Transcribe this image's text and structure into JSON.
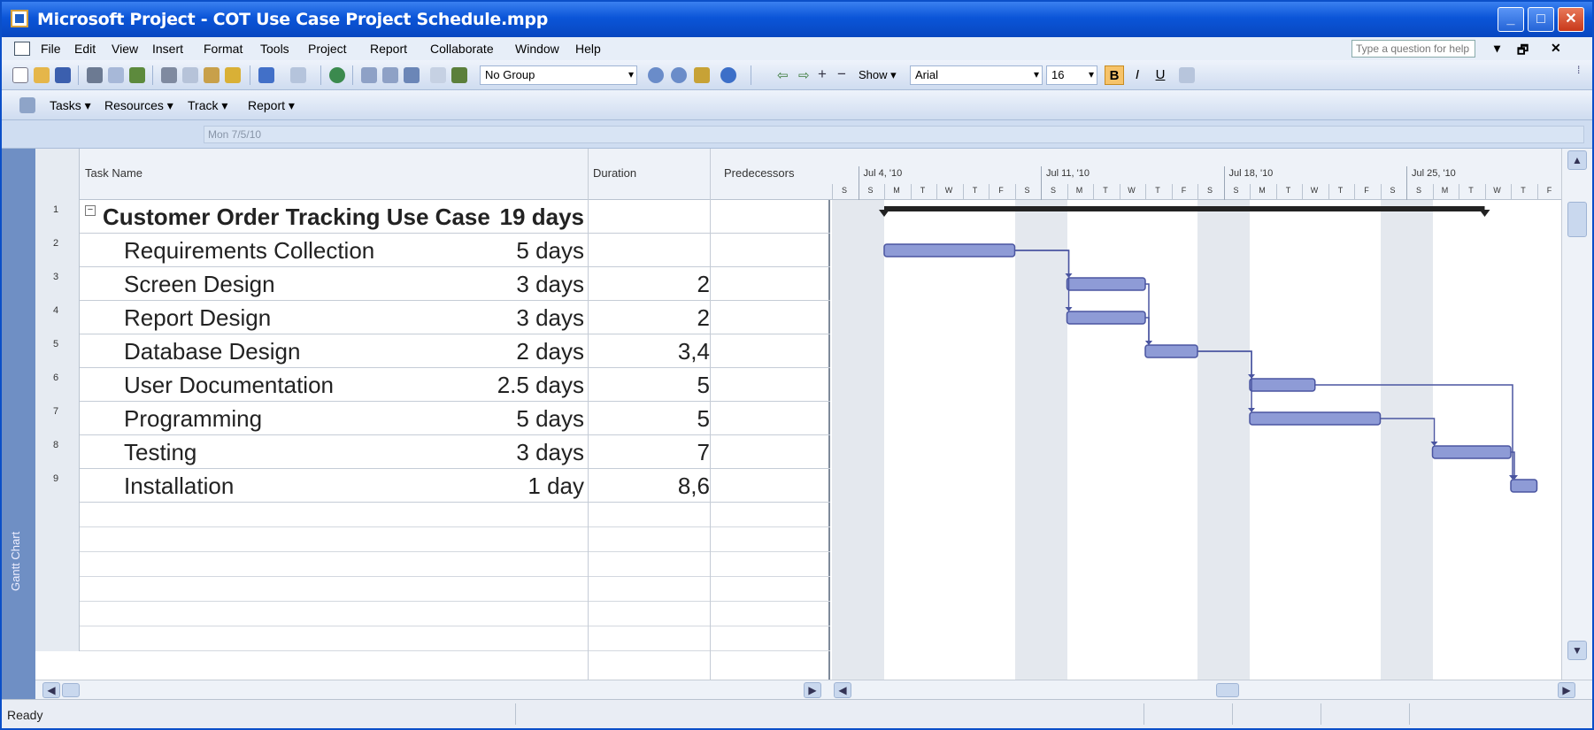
{
  "window": {
    "title": "Microsoft Project - COT Use Case Project Schedule.mpp"
  },
  "menu": {
    "items": [
      "File",
      "Edit",
      "View",
      "Insert",
      "Format",
      "Tools",
      "Project",
      "Report",
      "Collaborate",
      "Window",
      "Help"
    ],
    "help_placeholder": "Type a question for help"
  },
  "toolbar": {
    "group_combo": "No Group",
    "show_label": "Show",
    "font_combo": "Arial",
    "size_combo": "16",
    "bold": "B",
    "italic": "I",
    "underline": "U"
  },
  "project_guide": {
    "tasks": "Tasks",
    "resources": "Resources",
    "track": "Track",
    "report": "Report"
  },
  "entry_bar": {
    "value": "Mon 7/5/10"
  },
  "view_bar": {
    "label": "Gantt Chart"
  },
  "table": {
    "headers": {
      "task_name": "Task Name",
      "duration": "Duration",
      "predecessors": "Predecessors"
    },
    "rows": [
      {
        "id": "1",
        "name": "Customer Order Tracking Use Case",
        "duration": "19 days",
        "predecessors": "",
        "summary": true
      },
      {
        "id": "2",
        "name": "Requirements Collection",
        "duration": "5 days",
        "predecessors": ""
      },
      {
        "id": "3",
        "name": "Screen Design",
        "duration": "3 days",
        "predecessors": "2"
      },
      {
        "id": "4",
        "name": "Report Design",
        "duration": "3 days",
        "predecessors": "2"
      },
      {
        "id": "5",
        "name": "Database Design",
        "duration": "2 days",
        "predecessors": "3,4"
      },
      {
        "id": "6",
        "name": "User Documentation",
        "duration": "2.5 days",
        "predecessors": "5"
      },
      {
        "id": "7",
        "name": "Programming",
        "duration": "5 days",
        "predecessors": "5"
      },
      {
        "id": "8",
        "name": "Testing",
        "duration": "3 days",
        "predecessors": "7"
      },
      {
        "id": "9",
        "name": "Installation",
        "duration": "1 day",
        "predecessors": "8,6"
      }
    ]
  },
  "timescale": {
    "weeks": [
      "Jul 4, '10",
      "Jul 11, '10",
      "Jul 18, '10",
      "Jul 25, '10"
    ],
    "days": [
      "S",
      "S",
      "M",
      "T",
      "W",
      "T",
      "F",
      "S",
      "S",
      "M",
      "T",
      "W",
      "T",
      "F",
      "S",
      "S",
      "M",
      "T",
      "W",
      "T",
      "F",
      "S",
      "S",
      "M",
      "T",
      "W",
      "T",
      "F"
    ]
  },
  "gantt": {
    "start_day_index": 0,
    "bars": [
      {
        "row": 0,
        "start": 2,
        "end": 25,
        "summary": true
      },
      {
        "row": 1,
        "start": 2,
        "end": 7
      },
      {
        "row": 2,
        "start": 9,
        "end": 12
      },
      {
        "row": 3,
        "start": 9,
        "end": 12
      },
      {
        "row": 4,
        "start": 12,
        "end": 14
      },
      {
        "row": 5,
        "start": 16,
        "end": 18.5
      },
      {
        "row": 6,
        "start": 16,
        "end": 21
      },
      {
        "row": 7,
        "start": 23,
        "end": 26
      },
      {
        "row": 8,
        "start": 26,
        "end": 27
      }
    ],
    "links": [
      {
        "from": 1,
        "to": 2
      },
      {
        "from": 1,
        "to": 3
      },
      {
        "from": 2,
        "to": 4
      },
      {
        "from": 3,
        "to": 4
      },
      {
        "from": 4,
        "to": 5
      },
      {
        "from": 4,
        "to": 6
      },
      {
        "from": 6,
        "to": 7
      },
      {
        "from": 7,
        "to": 8
      },
      {
        "from": 5,
        "to": 8
      }
    ],
    "bar_color": "#8e9bd6"
  },
  "status": {
    "text": "Ready"
  }
}
